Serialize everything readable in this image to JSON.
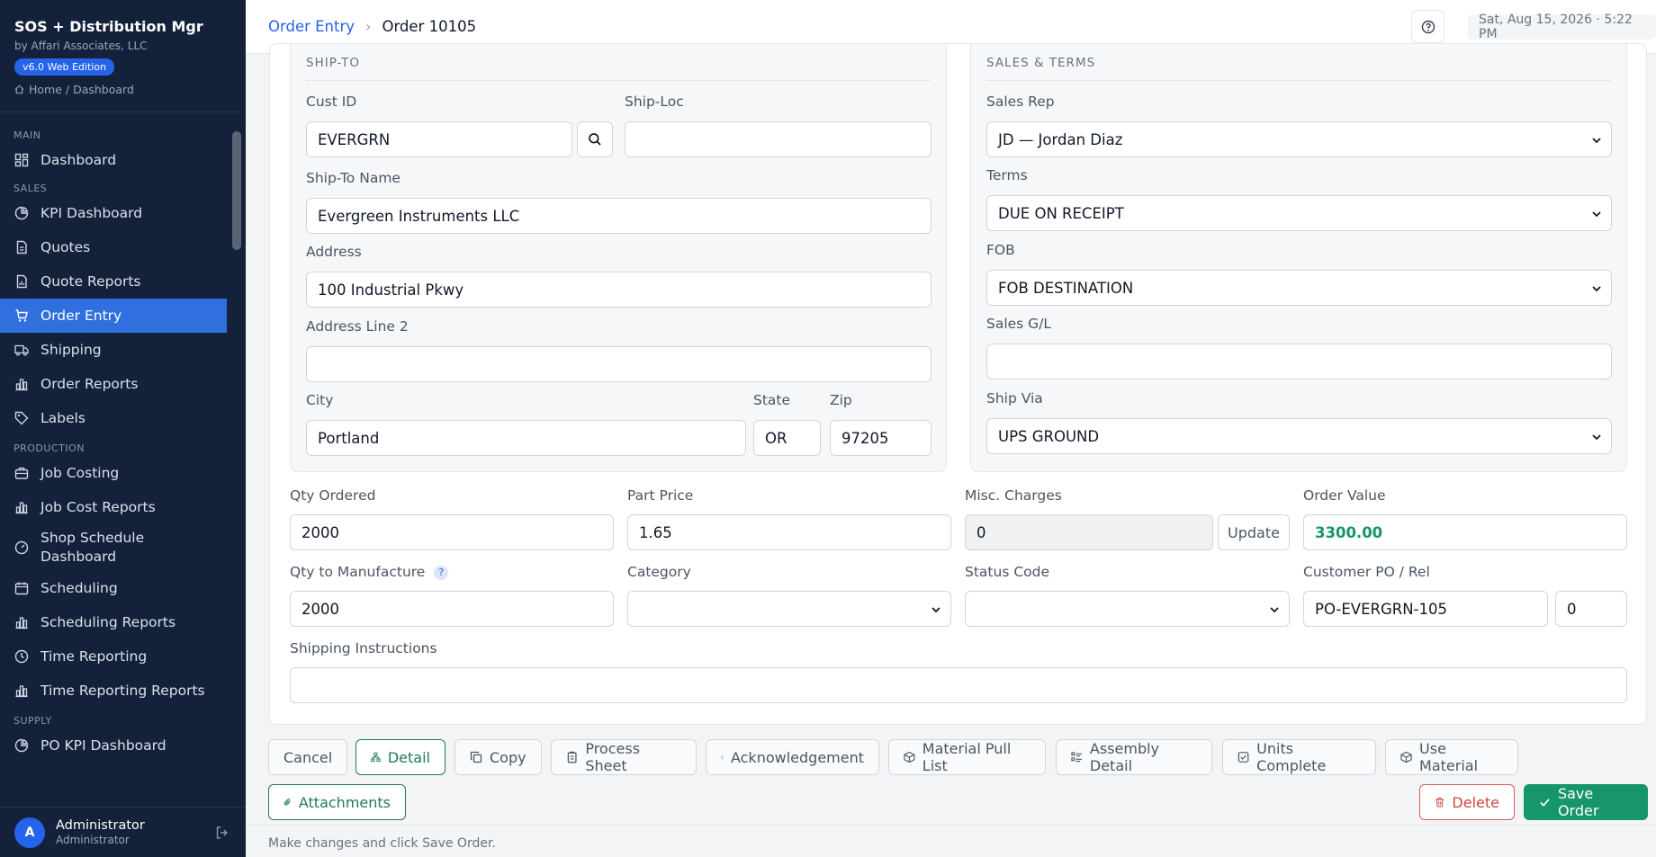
{
  "app": {
    "title": "SOS + Distribution Mgr",
    "vendor": "by Affari Associates, LLC",
    "edition": "v6.0 Web Edition",
    "breadcrumb": "Home / Dashboard"
  },
  "nav": {
    "main_label": "MAIN",
    "dashboard": "Dashboard",
    "sales_label": "SALES",
    "kpi_dashboard": "KPI Dashboard",
    "quotes": "Quotes",
    "quote_reports": "Quote Reports",
    "order_entry": "Order Entry",
    "shipping": "Shipping",
    "order_reports": "Order Reports",
    "labels": "Labels",
    "production_label": "PRODUCTION",
    "job_costing": "Job Costing",
    "job_cost_reports": "Job Cost Reports",
    "shop_schedule_1": "Shop Schedule",
    "shop_schedule_2": "Dashboard",
    "scheduling": "Scheduling",
    "scheduling_reports": "Scheduling Reports",
    "time_reporting": "Time Reporting",
    "time_reporting_reports": "Time Reporting Reports",
    "supply_label": "SUPPLY",
    "po_kpi_dashboard": "PO KPI Dashboard"
  },
  "user": {
    "initial": "A",
    "name": "Administrator",
    "role": "Administrator"
  },
  "header": {
    "section": "Order Entry",
    "current": "Order 10105",
    "datetime": "Sat, Aug 15, 2026 · 5:22 PM"
  },
  "ship_to": {
    "title": "SHIP-TO",
    "cust_id_label": "Cust ID",
    "cust_id": "EVERGRN",
    "ship_loc_label": "Ship-Loc",
    "ship_loc": "",
    "name_label": "Ship-To Name",
    "name": "Evergreen Instruments LLC",
    "address_label": "Address",
    "address": "100 Industrial Pkwy",
    "address2_label": "Address Line 2",
    "address2": "",
    "city_label": "City",
    "city": "Portland",
    "state_label": "State",
    "state": "OR",
    "zip_label": "Zip",
    "zip": "97205"
  },
  "sales_terms": {
    "title": "SALES & TERMS",
    "sales_rep_label": "Sales Rep",
    "sales_rep": "JD — Jordan Diaz",
    "terms_label": "Terms",
    "terms": "DUE ON RECEIPT",
    "fob_label": "FOB",
    "fob": "FOB DESTINATION",
    "sales_gl_label": "Sales G/L",
    "sales_gl": "",
    "ship_via_label": "Ship Via",
    "ship_via": "UPS GROUND"
  },
  "order": {
    "qty_ordered_label": "Qty Ordered",
    "qty_ordered": "2000",
    "part_price_label": "Part Price",
    "part_price": "1.65",
    "misc_charges_label": "Misc. Charges",
    "misc_charges": "0",
    "update_label": "Update",
    "order_value_label": "Order Value",
    "order_value": "3300.00",
    "qty_mfg_label": "Qty to Manufacture",
    "qty_mfg": "2000",
    "qty_mfg_help": "?",
    "category_label": "Category",
    "category": "",
    "status_code_label": "Status Code",
    "status_code": "",
    "customer_po_label": "Customer PO / Rel",
    "customer_po": "PO-EVERGRN-105",
    "release": "0",
    "shipping_instructions_label": "Shipping Instructions",
    "shipping_instructions": ""
  },
  "actions": {
    "cancel": "Cancel",
    "detail": "Detail",
    "copy": "Copy",
    "process_sheet": "Process Sheet",
    "acknowledgement": "Acknowledgement",
    "material_pull_list": "Material Pull List",
    "assembly_detail": "Assembly Detail",
    "units_complete": "Units Complete",
    "use_material": "Use Material",
    "attachments": "Attachments",
    "delete": "Delete",
    "save_order": "Save Order"
  },
  "hint": "Make changes and click Save Order.",
  "colors": {
    "sidebar_bg": "#14213a",
    "accent": "#2f6fde",
    "success": "#16966a",
    "danger": "#d14343"
  }
}
